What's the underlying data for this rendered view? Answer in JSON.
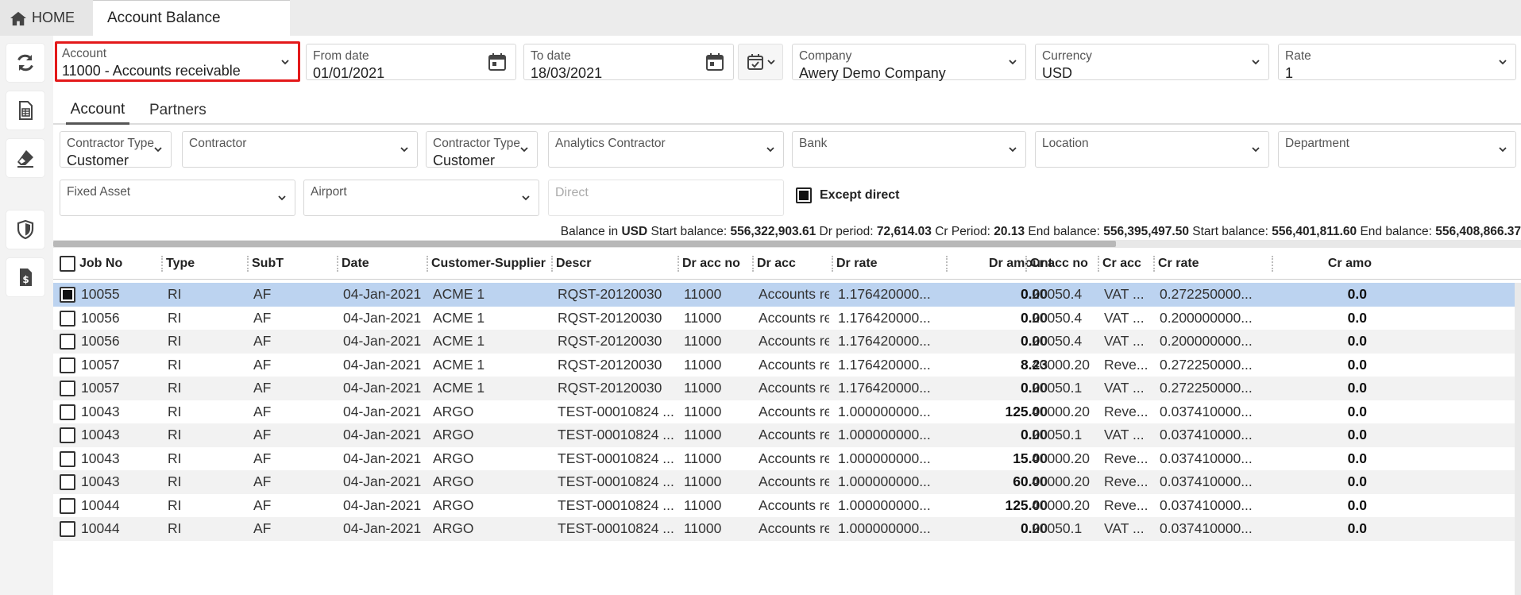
{
  "tabs": {
    "home": "HOME",
    "active": "Account Balance"
  },
  "filters": {
    "account": {
      "label": "Account",
      "value": "11000 - Accounts receivable"
    },
    "from_date": {
      "label": "From date",
      "value": "01/01/2021"
    },
    "to_date": {
      "label": "To date",
      "value": "18/03/2021"
    },
    "company": {
      "label": "Company",
      "value": "Awery Demo Company"
    },
    "currency": {
      "label": "Currency",
      "value": "USD"
    },
    "rate": {
      "label": "Rate",
      "value": "1"
    }
  },
  "subtabs": [
    "Account",
    "Partners"
  ],
  "filters2": {
    "contractor_type1": {
      "label": "Contractor Type",
      "value": "Customer"
    },
    "contractor": {
      "label": "Contractor",
      "value": ""
    },
    "contractor_type2": {
      "label": "Contractor Type",
      "value": "Customer"
    },
    "analytics_contractor": {
      "label": "Analytics Contractor",
      "value": ""
    },
    "bank": {
      "label": "Bank",
      "value": ""
    },
    "location": {
      "label": "Location",
      "value": ""
    },
    "department": {
      "label": "Department",
      "value": ""
    },
    "fixed_asset": {
      "label": "Fixed Asset",
      "value": ""
    },
    "airport": {
      "label": "Airport",
      "value": ""
    },
    "direct": {
      "placeholder": "Direct"
    },
    "except_direct": "Except direct"
  },
  "balance": {
    "prefix": "Balance in",
    "currency": "USD",
    "start_label": "Start balance:",
    "start": "556,322,903.61",
    "dr_label": "Dr period:",
    "dr": "72,614.03",
    "cr_label": "Cr Period:",
    "cr": "20.13",
    "end_label": "End balance:",
    "end": "556,395,497.50",
    "start2_label": "Start balance:",
    "start2": "556,401,811.60",
    "end2_label": "End balance:",
    "end2": "556,408,866.37"
  },
  "columns": [
    "Job No",
    "Type",
    "SubT",
    "Date",
    "Customer-Supplier",
    "Descr",
    "Dr acc no",
    "Dr acc",
    "Dr rate",
    "Dr amount",
    "Cr acc no",
    "Cr acc",
    "Cr rate",
    "Cr amo"
  ],
  "rows": [
    {
      "job": "10055",
      "type": "RI",
      "subt": "AF",
      "date": "04-Jan-2021",
      "cs": "ACME 1",
      "descr": "RQST-20120030",
      "dracc_no": "11000",
      "dracc": "Accounts rec...",
      "drrate": "1.176420000...",
      "dramt": "0.00",
      "cracc_no": "20050.4",
      "cracc": "VAT ...",
      "crrate": "0.272250000...",
      "cramt": "0.0"
    },
    {
      "job": "10056",
      "type": "RI",
      "subt": "AF",
      "date": "04-Jan-2021",
      "cs": "ACME 1",
      "descr": "RQST-20120030",
      "dracc_no": "11000",
      "dracc": "Accounts rec...",
      "drrate": "1.176420000...",
      "dramt": "0.00",
      "cracc_no": "20050.4",
      "cracc": "VAT ...",
      "crrate": "0.200000000...",
      "cramt": "0.0"
    },
    {
      "job": "10056",
      "type": "RI",
      "subt": "AF",
      "date": "04-Jan-2021",
      "cs": "ACME 1",
      "descr": "RQST-20120030",
      "dracc_no": "11000",
      "dracc": "Accounts rec...",
      "drrate": "1.176420000...",
      "dramt": "0.00",
      "cracc_no": "20050.4",
      "cracc": "VAT ...",
      "crrate": "0.200000000...",
      "cramt": "0.0"
    },
    {
      "job": "10057",
      "type": "RI",
      "subt": "AF",
      "date": "04-Jan-2021",
      "cs": "ACME 1",
      "descr": "RQST-20120030",
      "dracc_no": "11000",
      "dracc": "Accounts rec...",
      "drrate": "1.176420000...",
      "dramt": "8.23",
      "cracc_no": "40000.20",
      "cracc": "Reve...",
      "crrate": "0.272250000...",
      "cramt": "0.0"
    },
    {
      "job": "10057",
      "type": "RI",
      "subt": "AF",
      "date": "04-Jan-2021",
      "cs": "ACME 1",
      "descr": "RQST-20120030",
      "dracc_no": "11000",
      "dracc": "Accounts rec...",
      "drrate": "1.176420000...",
      "dramt": "0.00",
      "cracc_no": "20050.1",
      "cracc": "VAT ...",
      "crrate": "0.272250000...",
      "cramt": "0.0"
    },
    {
      "job": "10043",
      "type": "RI",
      "subt": "AF",
      "date": "04-Jan-2021",
      "cs": "ARGO",
      "descr": "TEST-00010824 ...",
      "dracc_no": "11000",
      "dracc": "Accounts rec...",
      "drrate": "1.000000000...",
      "dramt": "125.00",
      "cracc_no": "40000.20",
      "cracc": "Reve...",
      "crrate": "0.037410000...",
      "cramt": "0.0"
    },
    {
      "job": "10043",
      "type": "RI",
      "subt": "AF",
      "date": "04-Jan-2021",
      "cs": "ARGO",
      "descr": "TEST-00010824 ...",
      "dracc_no": "11000",
      "dracc": "Accounts rec...",
      "drrate": "1.000000000...",
      "dramt": "0.00",
      "cracc_no": "20050.1",
      "cracc": "VAT ...",
      "crrate": "0.037410000...",
      "cramt": "0.0"
    },
    {
      "job": "10043",
      "type": "RI",
      "subt": "AF",
      "date": "04-Jan-2021",
      "cs": "ARGO",
      "descr": "TEST-00010824 ...",
      "dracc_no": "11000",
      "dracc": "Accounts rec...",
      "drrate": "1.000000000...",
      "dramt": "15.00",
      "cracc_no": "40000.20",
      "cracc": "Reve...",
      "crrate": "0.037410000...",
      "cramt": "0.0"
    },
    {
      "job": "10043",
      "type": "RI",
      "subt": "AF",
      "date": "04-Jan-2021",
      "cs": "ARGO",
      "descr": "TEST-00010824 ...",
      "dracc_no": "11000",
      "dracc": "Accounts rec...",
      "drrate": "1.000000000...",
      "dramt": "60.00",
      "cracc_no": "40000.20",
      "cracc": "Reve...",
      "crrate": "0.037410000...",
      "cramt": "0.0"
    },
    {
      "job": "10044",
      "type": "RI",
      "subt": "AF",
      "date": "04-Jan-2021",
      "cs": "ARGO",
      "descr": "TEST-00010824 ...",
      "dracc_no": "11000",
      "dracc": "Accounts rec...",
      "drrate": "1.000000000...",
      "dramt": "125.00",
      "cracc_no": "40000.20",
      "cracc": "Reve...",
      "crrate": "0.037410000...",
      "cramt": "0.0"
    },
    {
      "job": "10044",
      "type": "RI",
      "subt": "AF",
      "date": "04-Jan-2021",
      "cs": "ARGO",
      "descr": "TEST-00010824 ...",
      "dracc_no": "11000",
      "dracc": "Accounts rec...",
      "drrate": "1.000000000...",
      "dramt": "0.00",
      "cracc_no": "20050.1",
      "cracc": "VAT ...",
      "crrate": "0.037410000...",
      "cramt": "0.0"
    }
  ],
  "selected_row": 0,
  "colors": {
    "selected_row": "#bcd3f0",
    "alt_row": "#f2f2f2",
    "active_border": "#e3191a"
  }
}
